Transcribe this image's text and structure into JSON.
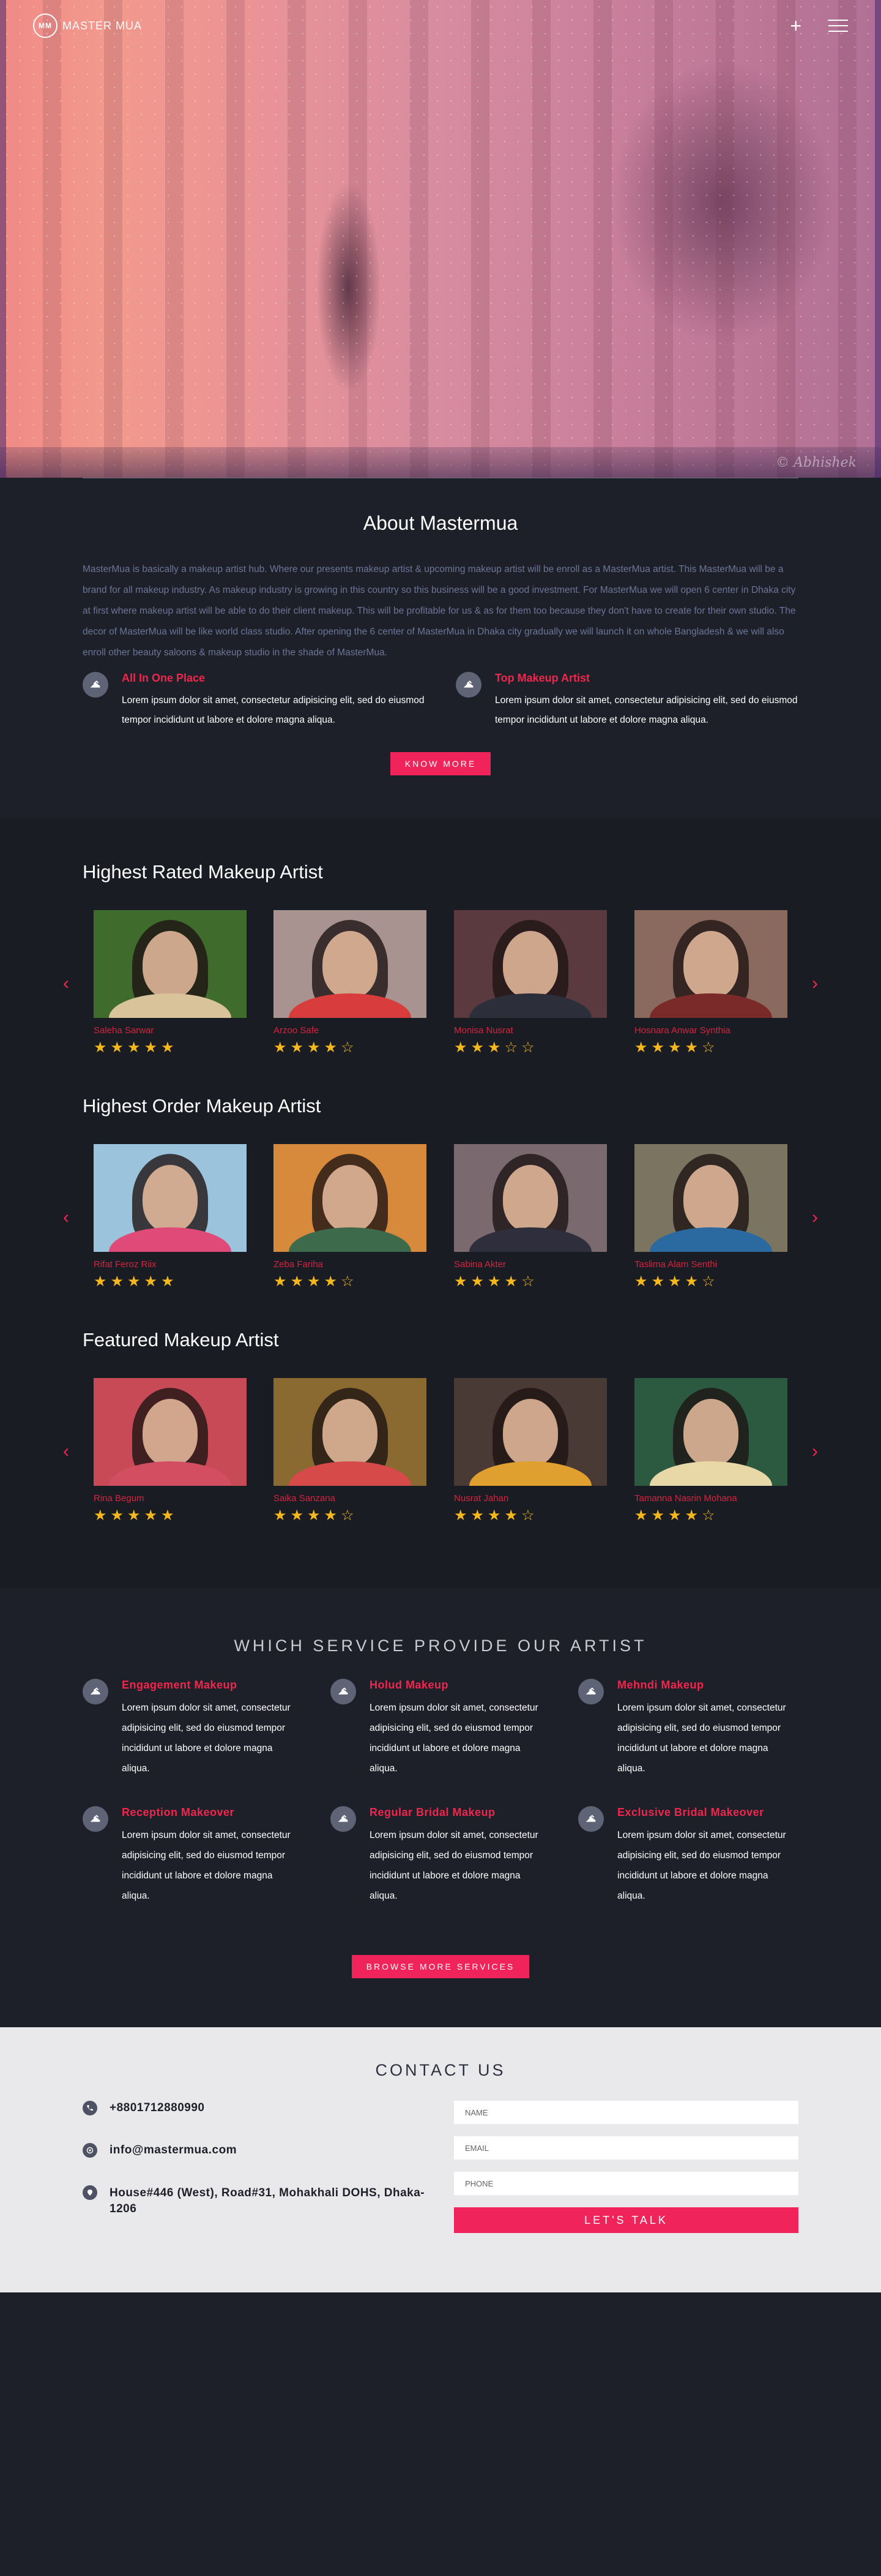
{
  "brand": {
    "logo_mark": "MM",
    "logo_text": "MASTER MUA",
    "watermark": "© Abhishek"
  },
  "nav": {
    "plus_icon": "plus-icon",
    "menu_icon": "hamburger-menu-icon"
  },
  "about": {
    "title": "About Mastermua",
    "description": "MasterMua is basically a makeup artist hub. Where our presents makeup artist & upcoming makeup artist will be enroll as a MasterMua artist. This MasterMua will be a brand for all makeup industry. As makeup industry is growing in this country so this business will be a good investment. For MasterMua we will open 6 center in Dhaka city at first where makeup artist will be able to do their client makeup. This will be profitable for us & as for them too because they don't have to create for their own studio. The decor of MasterMua will be like world class studio. After opening the 6 center of MasterMua in Dhaka city gradually we will launch it on whole Bangladesh & we will also enroll other beauty saloons & makeup studio in the shade of MasterMua.",
    "features": [
      {
        "title": "All In One Place",
        "text": "Lorem ipsum dolor sit amet, consectetur adipisicing elit, sed do eiusmod tempor incididunt ut labore et dolore magna aliqua."
      },
      {
        "title": "Top Makeup Artist",
        "text": "Lorem ipsum dolor sit amet, consectetur adipisicing elit, sed do eiusmod tempor incididunt ut labore et dolore magna aliqua."
      }
    ],
    "button": "KNOW MORE"
  },
  "artist_sections": [
    {
      "title": "Highest Rated Makeup Artist",
      "artists": [
        {
          "name": "Saleha Sarwar",
          "rating": 5,
          "bg": "#3f6b2c",
          "shirt": "#d8c39a"
        },
        {
          "name": "Arzoo Safe",
          "rating": 4,
          "bg": "#a89390",
          "shirt": "#d83c3c"
        },
        {
          "name": "Monisa Nusrat",
          "rating": 3,
          "bg": "#5a3a3e",
          "shirt": "#2c2f3a"
        },
        {
          "name": "Hosnara Anwar Synthia",
          "rating": 4,
          "bg": "#8a6a5e",
          "shirt": "#7b2a2a"
        }
      ]
    },
    {
      "title": "Highest Order Makeup Artist",
      "artists": [
        {
          "name": "Rifat Feroz Riix",
          "rating": 5,
          "bg": "#9cc3dc",
          "shirt": "#e04a78"
        },
        {
          "name": "Zeba Fariha",
          "rating": 4,
          "bg": "#d88a3c",
          "shirt": "#3c6a4a"
        },
        {
          "name": "Sabina Akter",
          "rating": 4,
          "bg": "#7a6a70",
          "shirt": "#2e2e3c"
        },
        {
          "name": "Taslima Alam Senthi",
          "rating": 4,
          "bg": "#7a7460",
          "shirt": "#2a6aa0"
        }
      ]
    },
    {
      "title": "Featured Makeup Artist",
      "artists": [
        {
          "name": "Rina Begum",
          "rating": 5,
          "bg": "#c74a56",
          "shirt": "#d44e62"
        },
        {
          "name": "Saika Sanzana",
          "rating": 4,
          "bg": "#8a6a30",
          "shirt": "#d64a4a"
        },
        {
          "name": "Nusrat Jahan",
          "rating": 4,
          "bg": "#4a3a36",
          "shirt": "#e0a030"
        },
        {
          "name": "Tamanna Nasrin Mohana",
          "rating": 4,
          "bg": "#2c5a40",
          "shirt": "#e8d8a8"
        }
      ]
    }
  ],
  "services": {
    "title": "WHICH SERVICE PROVIDE OUR ARTIST",
    "items": [
      {
        "title": "Engagement Makeup",
        "text": "Lorem ipsum dolor sit amet, consectetur adipisicing elit, sed do eiusmod tempor incididunt ut labore et dolore magna aliqua."
      },
      {
        "title": "Holud Makeup",
        "text": "Lorem ipsum dolor sit amet, consectetur adipisicing elit, sed do eiusmod tempor incididunt ut labore et dolore magna aliqua."
      },
      {
        "title": "Mehndi Makeup",
        "text": "Lorem ipsum dolor sit amet, consectetur adipisicing elit, sed do eiusmod tempor incididunt ut labore et dolore magna aliqua."
      },
      {
        "title": "Reception Makeover",
        "text": "Lorem ipsum dolor sit amet, consectetur adipisicing elit, sed do eiusmod tempor incididunt ut labore et dolore magna aliqua."
      },
      {
        "title": "Regular Bridal Makeup",
        "text": "Lorem ipsum dolor sit amet, consectetur adipisicing elit, sed do eiusmod tempor incididunt ut labore et dolore magna aliqua."
      },
      {
        "title": "Exclusive Bridal Makeover",
        "text": "Lorem ipsum dolor sit amet, consectetur adipisicing elit, sed do eiusmod tempor incididunt ut labore et dolore magna aliqua."
      }
    ],
    "button": "BROWSE MORE SERVICES"
  },
  "contact": {
    "title": "CONTACT US",
    "phone": "+8801712880990",
    "email": "info@mastermua.com",
    "address": "House#446 (West), Road#31, Mohakhali DOHS, Dhaka-1206",
    "form": {
      "name_placeholder": "NAME",
      "email_placeholder": "EMAIL",
      "phone_placeholder": "PHONE",
      "submit": "LET'S TALK"
    }
  },
  "colors": {
    "accent": "#f0245a",
    "star": "#f5b81c",
    "dark_bg": "#1e2029"
  }
}
